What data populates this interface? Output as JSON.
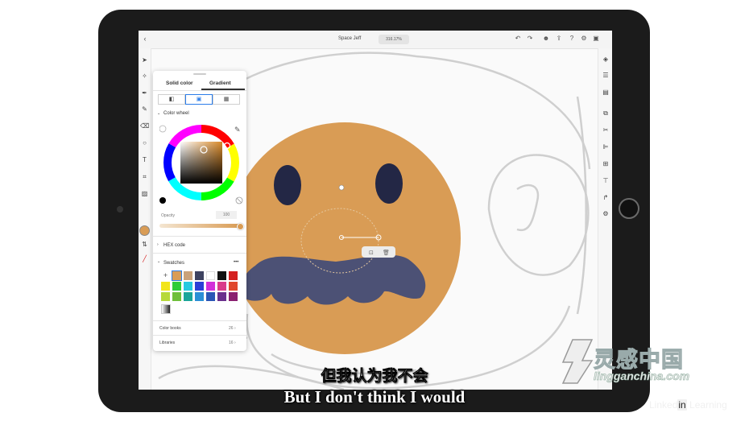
{
  "app": {
    "doc_title": "Space Jeff",
    "zoom": "316.17%",
    "back_icon": "chevron-left-icon",
    "top_icons": [
      "undo-icon",
      "redo-icon",
      "user-icon",
      "share-icon",
      "help-icon",
      "settings-icon",
      "export-icon"
    ]
  },
  "left_toolbar": {
    "tools": [
      "select-icon",
      "direct-select-icon",
      "pen-icon",
      "pencil-icon",
      "eraser-icon",
      "shape-icon",
      "text-icon",
      "crop-icon",
      "image-icon"
    ],
    "current_fill": "#d99c55"
  },
  "right_toolbar": {
    "tools": [
      "layers-icon",
      "properties-icon",
      "libraries-icon",
      "path-icon",
      "scissors-icon",
      "align-icon",
      "repeat-icon",
      "text-prop-icon",
      "curve-icon",
      "gear-icon"
    ]
  },
  "color_panel": {
    "tab_solid": "Solid color",
    "tab_gradient": "Gradient",
    "section_color_wheel": "Color wheel",
    "opacity_label": "Opacity",
    "opacity_value": "100",
    "hex_label": "HEX code",
    "swatches_label": "Swatches",
    "swatches_more": "•••",
    "color_books_label": "Color books",
    "color_books_count": "26 ›",
    "libraries_label": "Libraries",
    "libraries_count": "16 ›",
    "swatches": [
      [
        "+",
        "#d99c55",
        "#c9a27a",
        "#3d4260",
        "#ffffff",
        "#111111",
        "#d42020"
      ],
      [
        "#f2e51b",
        "#2ecc3a",
        "#24c9e0",
        "#2b3fd6",
        "#d22fd9",
        "#d93b8a",
        "#e0462c"
      ],
      [
        "#b7d93a",
        "#6fbf3b",
        "#1aa59a",
        "#2b8fd6",
        "#2a56b6",
        "#6a2f8c",
        "#8a2070"
      ]
    ]
  },
  "subtitle_cn": "但我认为我不会",
  "subtitle_en": "But I don't think I would",
  "watermark": {
    "brand_cn": "灵感中国",
    "url": "lingganchina.com",
    "li_text": "Linked",
    "li_in": "in",
    "li_learning": " Learning"
  }
}
